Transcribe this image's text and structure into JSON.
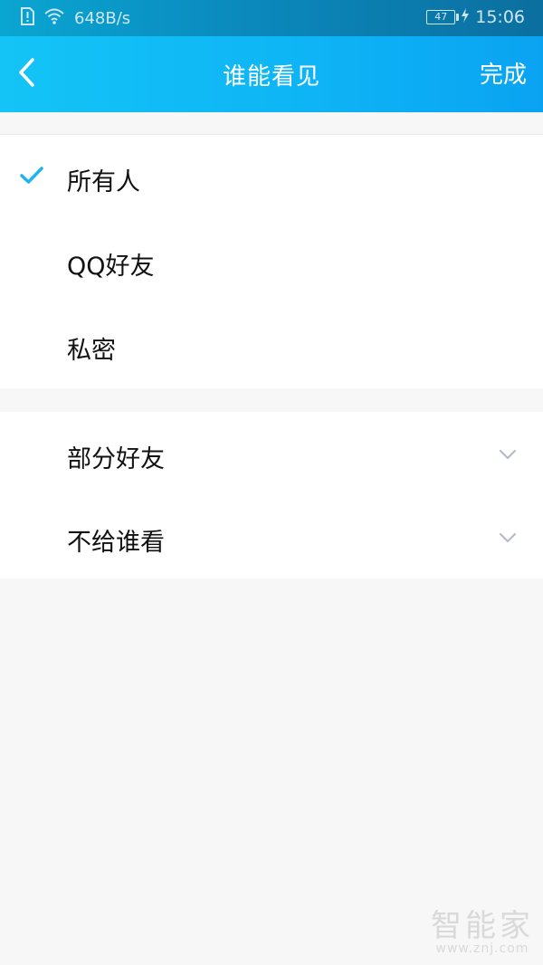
{
  "status_bar": {
    "network_speed": "648B/s",
    "battery_level": "47",
    "time": "15:06",
    "icons": [
      "sim-alert-icon",
      "wifi-icon",
      "battery-icon",
      "charging-icon"
    ]
  },
  "header": {
    "title": "谁能看见",
    "back_icon": "chevron-left-icon",
    "done_label": "完成"
  },
  "visibility_options": [
    {
      "label": "所有人",
      "selected": true
    },
    {
      "label": "QQ好友",
      "selected": false
    },
    {
      "label": "私密",
      "selected": false
    }
  ],
  "expandable_options": [
    {
      "label": "部分好友",
      "icon": "chevron-down-icon"
    },
    {
      "label": "不给谁看",
      "icon": "chevron-down-icon"
    }
  ],
  "watermark": {
    "logo_text": "智能家",
    "url_text": "www.znj.com"
  },
  "colors": {
    "accent": "#14c4f6",
    "check": "#1db4f0",
    "background": "#f7f7f7"
  }
}
